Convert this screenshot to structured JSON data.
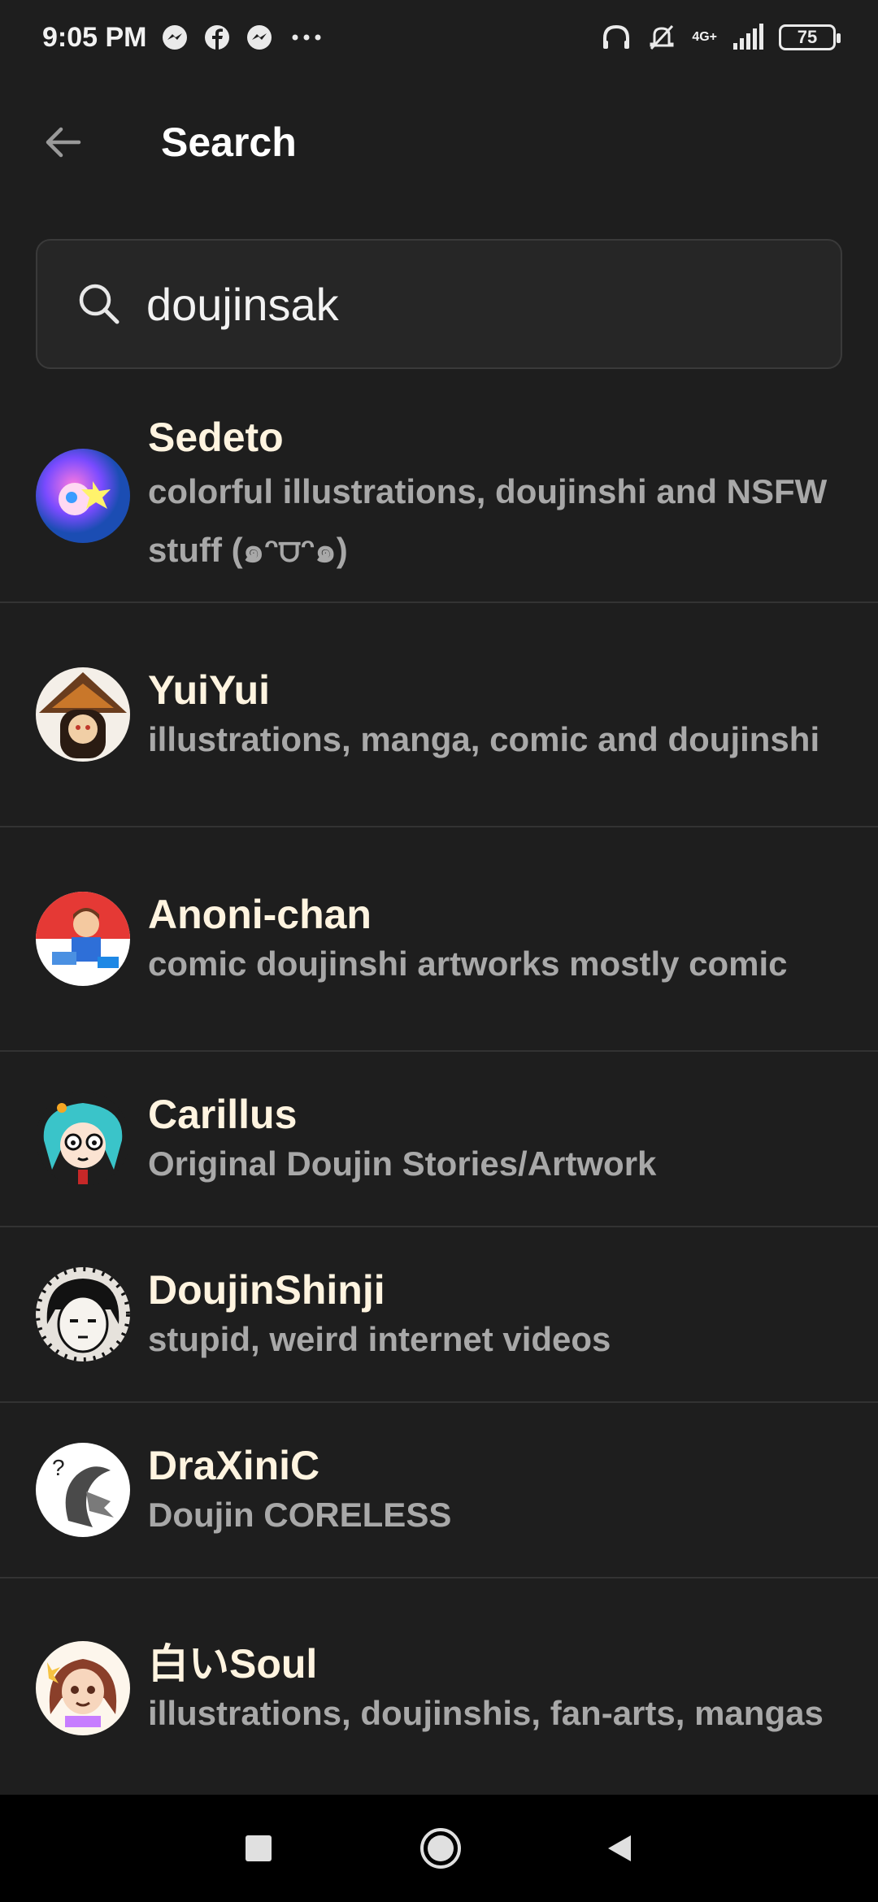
{
  "status_bar": {
    "time": "9:05 PM",
    "network": "4G+",
    "battery": "75",
    "icons": [
      "messenger-icon",
      "facebook-icon",
      "messenger-icon",
      "more-dots-icon",
      "headphones-icon",
      "mute-icon",
      "signal-icon",
      "battery-icon"
    ]
  },
  "header": {
    "title": "Search"
  },
  "search": {
    "value": "doujinsak"
  },
  "results": [
    {
      "name": "Sedeto",
      "description": "colorful illustrations, doujinshi and NSFW stuff (๑ᵔ⩌ᵔ๑)"
    },
    {
      "name": "YuiYui",
      "description": " illustrations, manga, comic and doujinshi"
    },
    {
      "name": "Anoni-chan",
      "description": "comic doujinshi artworks mostly comic"
    },
    {
      "name": "Carillus",
      "description": "Original Doujin Stories/Artwork"
    },
    {
      "name": "DoujinShinji",
      "description": "stupid, weird internet videos"
    },
    {
      "name": "DraXiniC",
      "description": "Doujin CORELESS"
    },
    {
      "name": "白いSoul",
      "description": "illustrations, doujinshis, fan-arts, mangas"
    }
  ],
  "colors": {
    "background": "#1e1e1e",
    "name_text": "#fff4e0",
    "desc_text": "#a8a8a8",
    "divider": "#333333"
  }
}
